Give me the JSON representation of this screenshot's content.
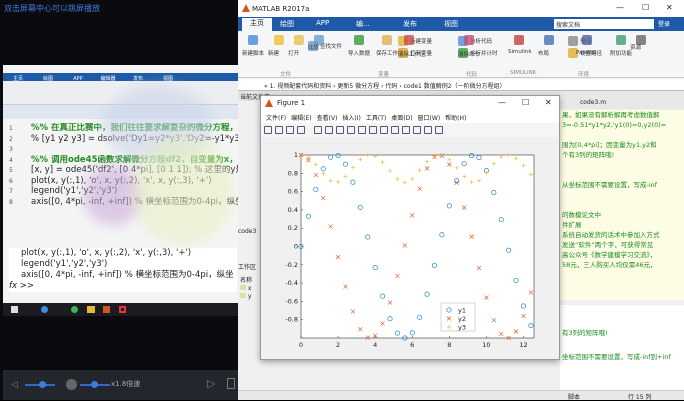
{
  "player": {
    "hint": "双击屏幕中心可以跳屏播放",
    "speed": "x1.8倍速",
    "inner_tabs": [
      "主页",
      "绘图",
      "APP",
      "编辑器",
      "发布",
      "视图"
    ],
    "code": [
      {
        "n": "1",
        "t": "%% 在真正比赛中，我们往往要求解复杂的微分方程，如果没有解析解",
        "c": true
      },
      {
        "n": "2",
        "t": "% [y1 y2 y3] = dsolve('Dy1=y2*y3','Dy2=-y1*y3','Dy3=-0.51*y1*y2')",
        "c": false
      },
      {
        "n": "3",
        "t": "",
        "c": false
      },
      {
        "n": "4",
        "t": "%% 调用ode45函数求解微分方程df2，自变量为x，范围",
        "c": true
      },
      {
        "n": "5",
        "t": "[x, y] = ode45('df2', [0 4*pi], [0 1 1]); % 这里的y是一个",
        "c": false
      },
      {
        "n": "6",
        "t": "plot(x, y(:,1), 'o', x, y(:,2), 'x', x, y(:,3), '+')",
        "c": false
      },
      {
        "n": "7",
        "t": "legend('y1','y2','y3')",
        "c": false
      },
      {
        "n": "8",
        "t": "axis([0, 4*pi, -inf, +inf]) % 横坐标范围为0-4pi，纵坐",
        "c": false
      }
    ],
    "cmd": [
      "plot(x, y(:,1), 'o', x, y(:,2), 'x', y(:,3), '+')",
      "legend('y1','y2','y3')",
      "axis([0, 4*pi, -inf, +inf]) % 横坐标范围为0-4pi，纵坐"
    ],
    "prompt": "fx >>"
  },
  "matlab": {
    "title": "MATLAB R2017a",
    "tabs": [
      "主页",
      "绘图",
      "APP",
      "编...",
      "发布",
      "视图"
    ],
    "search_placeholder": "搜索文档",
    "login": "登录",
    "ribbon": [
      "新建脚本",
      "新建",
      "打开",
      "查找文件",
      "比较",
      "导入数据",
      "保存工作区",
      "新建变量",
      "打开变量",
      "清除工作区",
      "分析代码",
      "运行并计时",
      "清除命令",
      "Simulink",
      "布局",
      "预设",
      "设置路径",
      "Parallel",
      "附加功能",
      "资源"
    ],
    "groups": [
      "文件",
      "变量",
      "代码",
      "SIMULINK",
      "环境"
    ],
    "path": "« 1. 视频配套代码和资料 › 更新5 微分方程 › 代码 › code1 数值解例2（一阶微分方程组）",
    "current_folder": "当前文件夹",
    "workspace": "工作区",
    "name_col": "名称",
    "vars": [
      "x",
      "y"
    ],
    "file_item": "code3",
    "editor_tab": "code3.m",
    "editor_lines": [
      "果，如果没有解析解再考虑数值解",
      "3=-0.51*y1*y2,'y1(0)=0,y2(0)=",
      "",
      "围为[0,4*pi]；因变量为y1,y2和",
      "个有3列的矩阵哦!",
      "",
      "",
      "从坐标范围不需要设置，写成-inf",
      "",
      "",
      "的数模论文中",
      "件扩展",
      "系统自动发货的话术中参加入方式",
      "发送“软件”两个字，可获得常见",
      "高公众号《数学建模学习交流》，",
      "58元，三人购买人均仅需46元，"
    ],
    "cmd_lines": [
      "有3列的矩阵哦!",
      "",
      "坐标范围不需要设置，写成-inf到+inf"
    ],
    "status_left": "脚本",
    "status_right": "行 15 列"
  },
  "figure": {
    "title": "Figure 1",
    "menu": [
      "文件(F)",
      "编辑(E)",
      "查看(V)",
      "插入(I)",
      "工具(T)",
      "桌面(D)",
      "窗口(W)",
      "帮助(H)"
    ]
  },
  "chart_data": {
    "type": "scatter",
    "title": "",
    "xlabel": "",
    "ylabel": "",
    "xlim": [
      0,
      12.566
    ],
    "ylim": [
      -1,
      1
    ],
    "xticks": [
      0,
      2,
      4,
      6,
      8,
      10,
      12
    ],
    "yticks": [
      1,
      0.8,
      0.6,
      0.4,
      0.2,
      0,
      -0.2,
      -0.4,
      -0.6,
      -0.8
    ],
    "legend_position": "bottom-right",
    "x": [
      0,
      0.4,
      0.8,
      1.2,
      1.6,
      2.0,
      2.4,
      2.8,
      3.2,
      3.6,
      4.0,
      4.4,
      4.8,
      5.2,
      5.6,
      6.0,
      6.4,
      6.8,
      7.2,
      7.6,
      8.0,
      8.4,
      8.8,
      9.2,
      9.6,
      10.0,
      10.4,
      10.8,
      11.2,
      11.6,
      12.0,
      12.4
    ],
    "series": [
      {
        "name": "y1",
        "marker": "o",
        "color": "#0072bd",
        "values": [
          0,
          0.331,
          0.625,
          0.848,
          0.976,
          0.993,
          0.899,
          0.703,
          0.428,
          0.104,
          -0.231,
          -0.542,
          -0.79,
          -0.947,
          -1.0,
          -0.944,
          -0.774,
          -0.521,
          -0.207,
          0.128,
          0.444,
          0.718,
          0.905,
          0.994,
          0.972,
          0.829,
          0.591,
          0.292,
          -0.041,
          -0.371,
          -0.65,
          -0.865
        ]
      },
      {
        "name": "y2",
        "marker": "x",
        "color": "#d95319",
        "values": [
          1,
          0.944,
          0.781,
          0.529,
          0.219,
          -0.116,
          -0.438,
          -0.711,
          -0.904,
          -0.995,
          -0.973,
          -0.841,
          -0.613,
          -0.32,
          0.012,
          0.341,
          0.632,
          0.854,
          0.978,
          0.992,
          0.896,
          0.696,
          0.425,
          0.108,
          -0.237,
          -0.559,
          -0.807,
          -0.956,
          -0.999,
          -0.929,
          -0.76,
          -0.502
        ]
      },
      {
        "name": "y3",
        "marker": "+",
        "color": "#edb120",
        "values": [
          1,
          0.972,
          0.895,
          0.796,
          0.717,
          0.705,
          0.767,
          0.865,
          0.952,
          0.997,
          0.986,
          0.922,
          0.826,
          0.737,
          0.7,
          0.738,
          0.834,
          0.928,
          0.989,
          0.996,
          0.948,
          0.859,
          0.763,
          0.704,
          0.72,
          0.806,
          0.906,
          0.978,
          0.999,
          0.964,
          0.886,
          0.786
        ]
      }
    ]
  }
}
